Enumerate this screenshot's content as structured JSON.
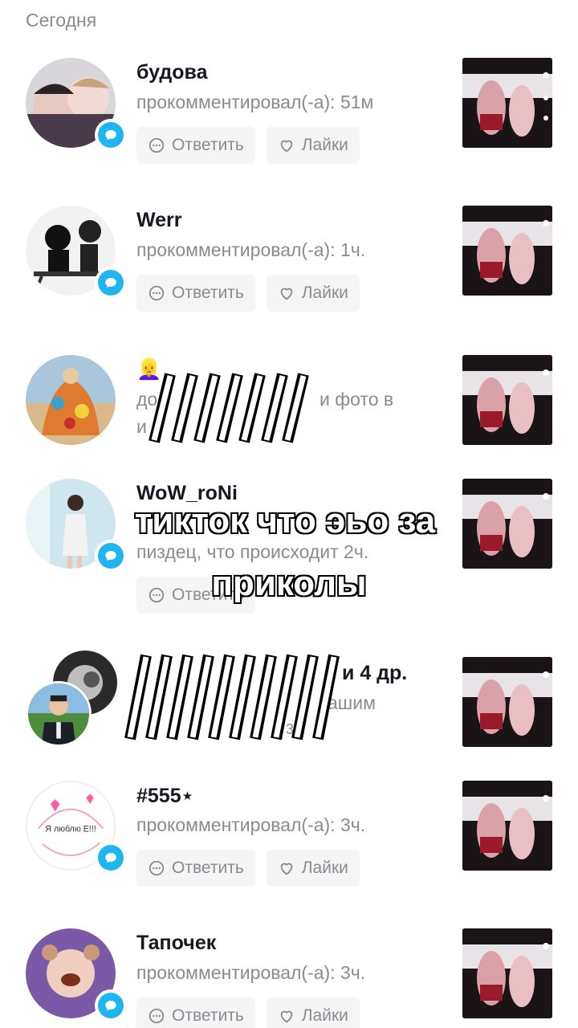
{
  "section": {
    "title": "Сегодня"
  },
  "actions": {
    "reply_label": "Ответить",
    "like_label": "Лайки"
  },
  "rows": [
    {
      "name": "будова",
      "text": "прокомментировал(-а): 51м"
    },
    {
      "name": "Werr",
      "text": "прокомментировал(-а): 1ч."
    },
    {
      "name": "👱‍♀️",
      "text_left": "до",
      "text_right": "и фото в",
      "text_line2": "и"
    },
    {
      "name": "WoW_roNi",
      "text": "пиздец, что происходит 2ч."
    },
    {
      "name_right": "и 4 др.",
      "text_right": "ашим",
      "text_line2": "3ч."
    },
    {
      "name": "#555⋆",
      "text": "прокомментировал(-а): 3ч."
    },
    {
      "name": "Тапочек",
      "text": "прокомментировал(-а): 3ч."
    }
  ],
  "overlay": {
    "caption_line1": "тикток что эьо за",
    "caption_line2": "приколы"
  },
  "colors": {
    "accent": "#20b5f0",
    "muted": "#8a8b91",
    "pill_bg": "#f5f5f6"
  },
  "icons": {
    "badge": "comment-bubble-icon",
    "reply": "comment-icon",
    "like": "heart-icon"
  }
}
